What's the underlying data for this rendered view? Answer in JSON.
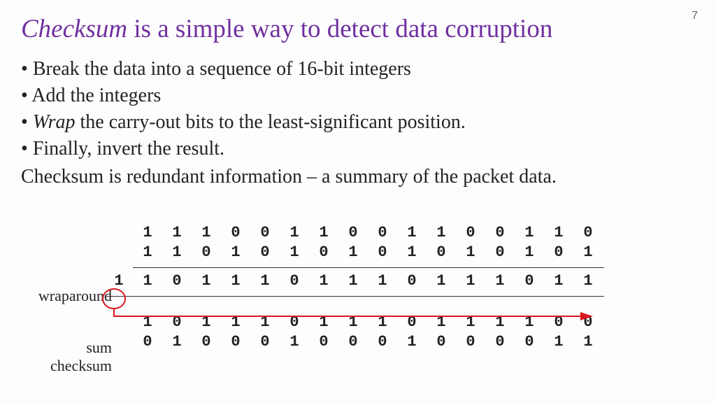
{
  "page_number": "7",
  "title_italic": "Checksum",
  "title_rest": " is a simple way to detect data corruption",
  "bullets": {
    "b1": "Break the data into a sequence of 16-bit integers",
    "b2": "Add the integers",
    "b3_em": "Wrap",
    "b3_rest": " the carry-out bits to the least-significant position.",
    "b4": "Finally, invert the result."
  },
  "summary": "Checksum is redundant information – a summary of the packet data.",
  "labels": {
    "wraparound": "wraparound",
    "sum": "sum",
    "checksum": "checksum"
  },
  "rows": {
    "a": [
      "1",
      "1",
      "1",
      "0",
      "0",
      "1",
      "1",
      "0",
      "0",
      "1",
      "1",
      "0",
      "0",
      "1",
      "1",
      "0"
    ],
    "b": [
      "1",
      "1",
      "0",
      "1",
      "0",
      "1",
      "0",
      "1",
      "0",
      "1",
      "0",
      "1",
      "0",
      "1",
      "0",
      "1"
    ],
    "carry": "1",
    "pre": [
      "1",
      "0",
      "1",
      "1",
      "1",
      "0",
      "1",
      "1",
      "1",
      "0",
      "1",
      "1",
      "1",
      "0",
      "1",
      "1"
    ],
    "sum": [
      "1",
      "0",
      "1",
      "1",
      "1",
      "0",
      "1",
      "1",
      "1",
      "0",
      "1",
      "1",
      "1",
      "1",
      "0",
      "0"
    ],
    "chk": [
      "0",
      "1",
      "0",
      "0",
      "0",
      "1",
      "0",
      "0",
      "0",
      "1",
      "0",
      "0",
      "0",
      "0",
      "1",
      "1"
    ]
  }
}
